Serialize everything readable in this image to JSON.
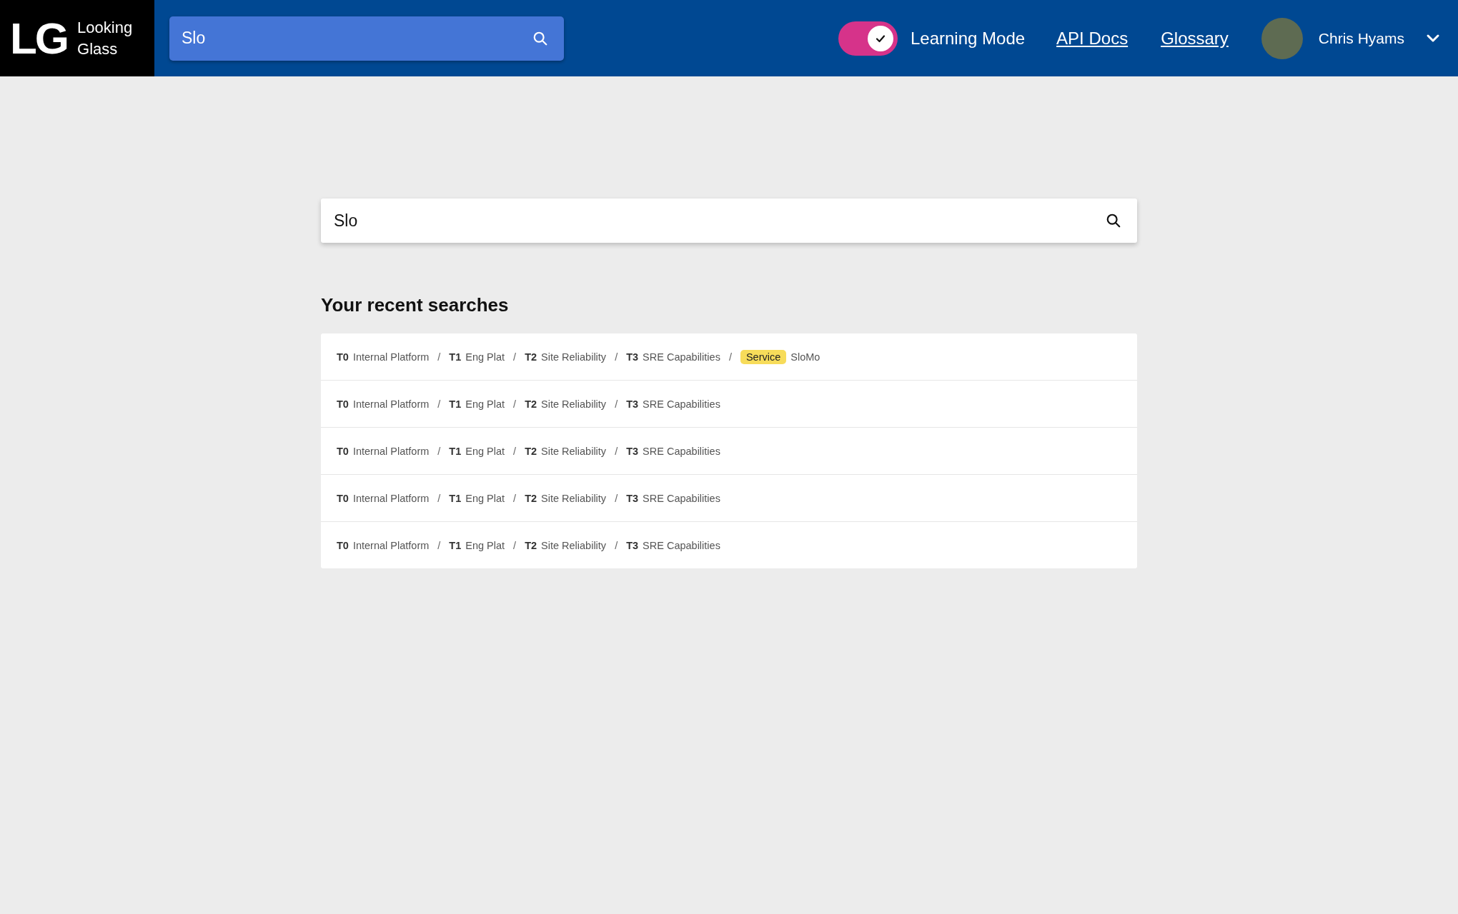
{
  "header": {
    "logo": {
      "mark": "LG",
      "name_line_1": "Looking",
      "name_line_2": "Glass"
    },
    "search": {
      "value": "Slo"
    },
    "learning_mode": {
      "label": "Learning Mode",
      "on": true
    },
    "links": [
      "API Docs",
      "Glossary"
    ],
    "user": {
      "name": "Chris Hyams"
    }
  },
  "search": {
    "value": "Slo"
  },
  "recent": {
    "title": "Your recent searches",
    "rows": [
      {
        "segments": [
          {
            "kind": "tier",
            "tier": "T0",
            "name": "Internal Platform"
          },
          {
            "kind": "tier",
            "separator": "/",
            "tier": "T1",
            "name": "Eng Plat"
          },
          {
            "kind": "tier",
            "separator": "/",
            "tier": "T2",
            "name": "Site Reliability"
          },
          {
            "kind": "tier",
            "separator": "/",
            "tier": "T3",
            "name": "SRE Capabilities"
          },
          {
            "kind": "badge",
            "separator": "/",
            "badge": "Service",
            "name": "SloMo"
          }
        ]
      },
      {
        "segments": [
          {
            "kind": "tier",
            "tier": "T0",
            "name": "Internal Platform"
          },
          {
            "kind": "tier",
            "separator": "/",
            "tier": "T1",
            "name": "Eng Plat"
          },
          {
            "kind": "tier",
            "separator": "/",
            "tier": "T2",
            "name": "Site Reliability"
          },
          {
            "kind": "tier",
            "separator": "/",
            "tier": "T3",
            "name": "SRE Capabilities"
          }
        ]
      },
      {
        "segments": [
          {
            "kind": "tier",
            "tier": "T0",
            "name": "Internal Platform"
          },
          {
            "kind": "tier",
            "separator": "/",
            "tier": "T1",
            "name": "Eng Plat"
          },
          {
            "kind": "tier",
            "separator": "/",
            "tier": "T2",
            "name": "Site Reliability"
          },
          {
            "kind": "tier",
            "separator": "/",
            "tier": "T3",
            "name": "SRE Capabilities"
          }
        ]
      },
      {
        "segments": [
          {
            "kind": "tier",
            "tier": "T0",
            "name": "Internal Platform"
          },
          {
            "kind": "tier",
            "separator": "/",
            "tier": "T1",
            "name": "Eng Plat"
          },
          {
            "kind": "tier",
            "separator": "/",
            "tier": "T2",
            "name": "Site Reliability"
          },
          {
            "kind": "tier",
            "separator": "/",
            "tier": "T3",
            "name": "SRE Capabilities"
          }
        ]
      },
      {
        "segments": [
          {
            "kind": "tier",
            "tier": "T0",
            "name": "Internal Platform"
          },
          {
            "kind": "tier",
            "separator": "/",
            "tier": "T1",
            "name": "Eng Plat"
          },
          {
            "kind": "tier",
            "separator": "/",
            "tier": "T2",
            "name": "Site Reliability"
          },
          {
            "kind": "tier",
            "separator": "/",
            "tier": "T3",
            "name": "SRE Capabilities"
          }
        ]
      }
    ]
  }
}
